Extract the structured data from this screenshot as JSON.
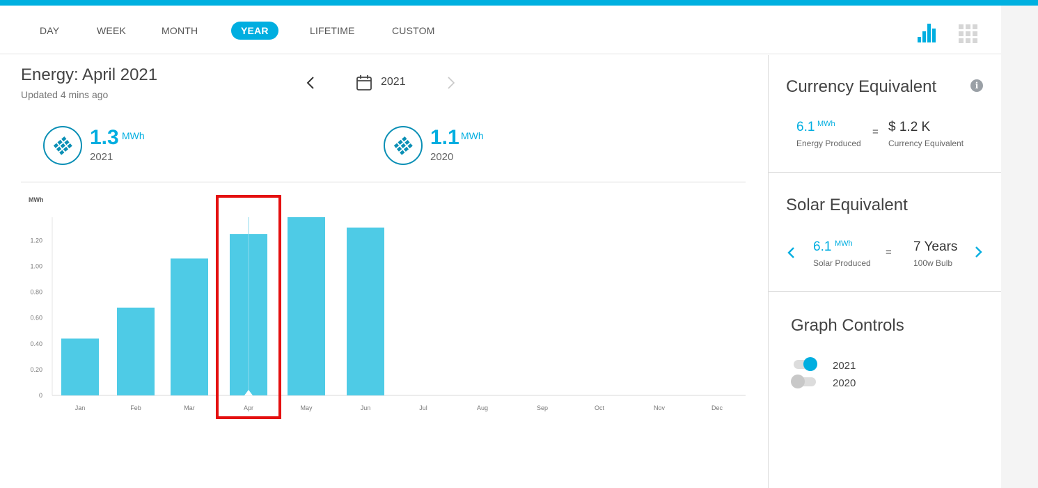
{
  "tabs": [
    {
      "label": "DAY",
      "active": false
    },
    {
      "label": "WEEK",
      "active": false
    },
    {
      "label": "MONTH",
      "active": false
    },
    {
      "label": "YEAR",
      "active": true
    },
    {
      "label": "LIFETIME",
      "active": false
    },
    {
      "label": "CUSTOM",
      "active": false
    }
  ],
  "view_icons": {
    "chart": "bar-chart-icon",
    "grid": "grid-icon"
  },
  "header": {
    "title": "Energy: April 2021",
    "updated": "Updated 4 mins ago",
    "year": "2021"
  },
  "kpis": [
    {
      "value": "1.3",
      "unit": "MWh",
      "label": "2021",
      "icon": "solar-panel-icon"
    },
    {
      "value": "1.1",
      "unit": "MWh",
      "label": "2020",
      "icon": "solar-panel-icon"
    }
  ],
  "chart_data": {
    "type": "bar",
    "ylabel": "MWh",
    "categories": [
      "Jan",
      "Feb",
      "Mar",
      "Apr",
      "May",
      "Jun",
      "Jul",
      "Aug",
      "Sep",
      "Oct",
      "Nov",
      "Dec"
    ],
    "series": [
      {
        "name": "2021",
        "values": [
          0.44,
          0.68,
          1.06,
          1.25,
          1.38,
          1.3,
          null,
          null,
          null,
          null,
          null,
          null
        ]
      }
    ],
    "yticks": [
      "0",
      "0.20",
      "0.40",
      "0.60",
      "0.80",
      "1.00",
      "1.20"
    ],
    "ylim": [
      0,
      1.38
    ],
    "selected_category": "Apr",
    "highlight_box_color": "#e41010",
    "bar_color": "#4ecbe6"
  },
  "currency": {
    "title": "Currency Equivalent",
    "energy_value": "6.1",
    "energy_unit": "MWh",
    "energy_label": "Energy Produced",
    "equals": "=",
    "currency_value": "$ 1.2 K",
    "currency_label": "Currency Equivalent"
  },
  "solar": {
    "title": "Solar Equivalent",
    "value": "6.1",
    "unit": "MWh",
    "label": "Solar Produced",
    "equals": "=",
    "equiv_value": "7 Years",
    "equiv_label": "100w Bulb"
  },
  "graph_controls": {
    "title": "Graph Controls",
    "items": [
      {
        "label": "2021",
        "on": true
      },
      {
        "label": "2020",
        "on": false
      }
    ]
  },
  "colors": {
    "accent": "#00aee0",
    "dark_accent": "#0a8fb5"
  }
}
